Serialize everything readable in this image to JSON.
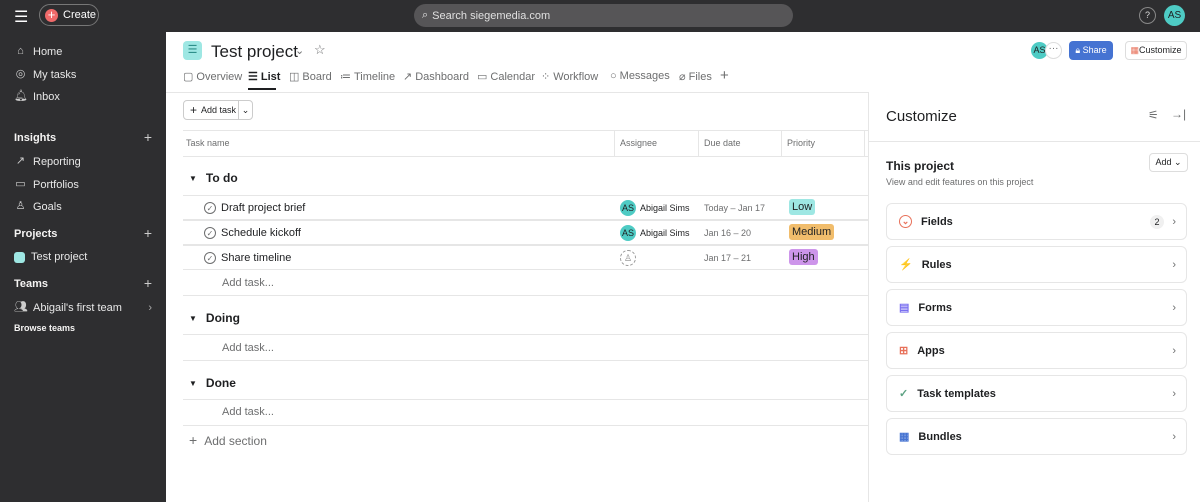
{
  "topbar": {
    "create": "Create",
    "search_placeholder": "Search siegemedia.com",
    "help": "?",
    "avatar": "AS"
  },
  "sidebar": {
    "items": [
      {
        "label": "Home",
        "icon": "home-icon"
      },
      {
        "label": "My tasks",
        "icon": "check-circle-icon"
      },
      {
        "label": "Inbox",
        "icon": "bell-icon"
      }
    ],
    "insights": {
      "title": "Insights",
      "items": [
        {
          "label": "Reporting"
        },
        {
          "label": "Portfolios"
        },
        {
          "label": "Goals"
        }
      ]
    },
    "projects": {
      "title": "Projects",
      "items": [
        {
          "label": "Test project"
        }
      ]
    },
    "teams": {
      "title": "Teams",
      "items": [
        {
          "label": "Abigail's first team"
        }
      ],
      "browse": "Browse teams"
    }
  },
  "header": {
    "title": "Test project",
    "share": "Share",
    "customize": "Customize",
    "avatar": "AS",
    "tabs": [
      {
        "label": "Overview",
        "icon": "▢"
      },
      {
        "label": "List",
        "icon": "☰"
      },
      {
        "label": "Board",
        "icon": "◫"
      },
      {
        "label": "Timeline",
        "icon": "≔"
      },
      {
        "label": "Dashboard",
        "icon": "↗"
      },
      {
        "label": "Calendar",
        "icon": "▭"
      },
      {
        "label": "Workflow",
        "icon": "⁘"
      },
      {
        "label": "Messages",
        "icon": "○"
      },
      {
        "label": "Files",
        "icon": "⌀"
      }
    ]
  },
  "list": {
    "add_task": "Add task",
    "columns": [
      "Task name",
      "Assignee",
      "Due date",
      "Priority"
    ],
    "sections": [
      {
        "name": "To do",
        "tasks": [
          {
            "name": "Draft project brief",
            "assignee": "Abigail Sims",
            "initials": "AS",
            "due": "Today – Jan 17",
            "priority": "Low",
            "color": "#9ee7e3"
          },
          {
            "name": "Schedule kickoff",
            "assignee": "Abigail Sims",
            "initials": "AS",
            "due": "Jan 16 – 20",
            "priority": "Medium",
            "color": "#f1bd6c"
          },
          {
            "name": "Share timeline",
            "assignee": "",
            "initials": "",
            "due": "Jan 17 – 21",
            "priority": "High",
            "color": "#cd95ea"
          }
        ]
      },
      {
        "name": "Doing",
        "tasks": []
      },
      {
        "name": "Done",
        "tasks": []
      }
    ],
    "add_task_row": "Add task...",
    "add_section": "Add section"
  },
  "panel": {
    "title": "Customize",
    "subtitle": "This project",
    "description": "View and edit features on this project",
    "add": "Add",
    "cards": [
      {
        "label": "Fields",
        "badge": "2",
        "icon": "⌄",
        "color": "#e8715a"
      },
      {
        "label": "Rules",
        "icon": "⚡",
        "color": "#f1bd6c"
      },
      {
        "label": "Forms",
        "icon": "▤",
        "color": "#7a6ff0"
      },
      {
        "label": "Apps",
        "icon": "⊞",
        "color": "#e8715a"
      },
      {
        "label": "Task templates",
        "icon": "✓",
        "color": "#5da283"
      },
      {
        "label": "Bundles",
        "icon": "▦",
        "color": "#4573d2"
      }
    ]
  }
}
